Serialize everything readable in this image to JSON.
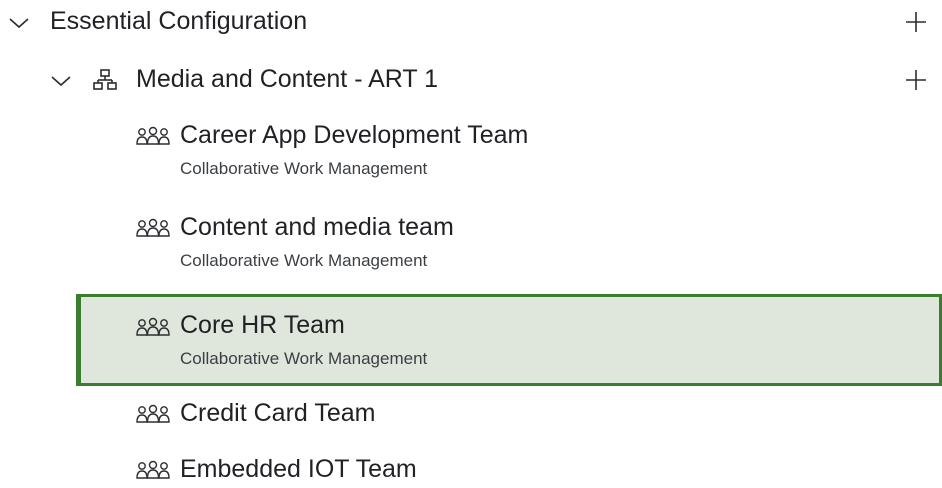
{
  "tree": {
    "root": {
      "label": "Essential Configuration",
      "expanded": true,
      "add_icon": "plus-icon",
      "children": [
        {
          "label": "Media and Content - ART 1",
          "icon": "org-chart-icon",
          "expanded": true,
          "add_icon": "plus-icon",
          "teams": [
            {
              "name": "Career App Development Team",
              "subtitle": "Collaborative Work Management",
              "selected": false
            },
            {
              "name": "Content and media team",
              "subtitle": "Collaborative Work Management",
              "selected": false
            },
            {
              "name": "Core HR Team",
              "subtitle": "Collaborative Work Management",
              "selected": true
            },
            {
              "name": "Credit Card Team",
              "subtitle": "",
              "selected": false
            },
            {
              "name": "Embedded IOT Team",
              "subtitle": "",
              "selected": false
            }
          ]
        }
      ]
    }
  },
  "colors": {
    "selected_background": "#dfe6dc",
    "selected_border": "#3a7d2c",
    "text": "#1f2124",
    "subtext": "#3b3f44"
  }
}
